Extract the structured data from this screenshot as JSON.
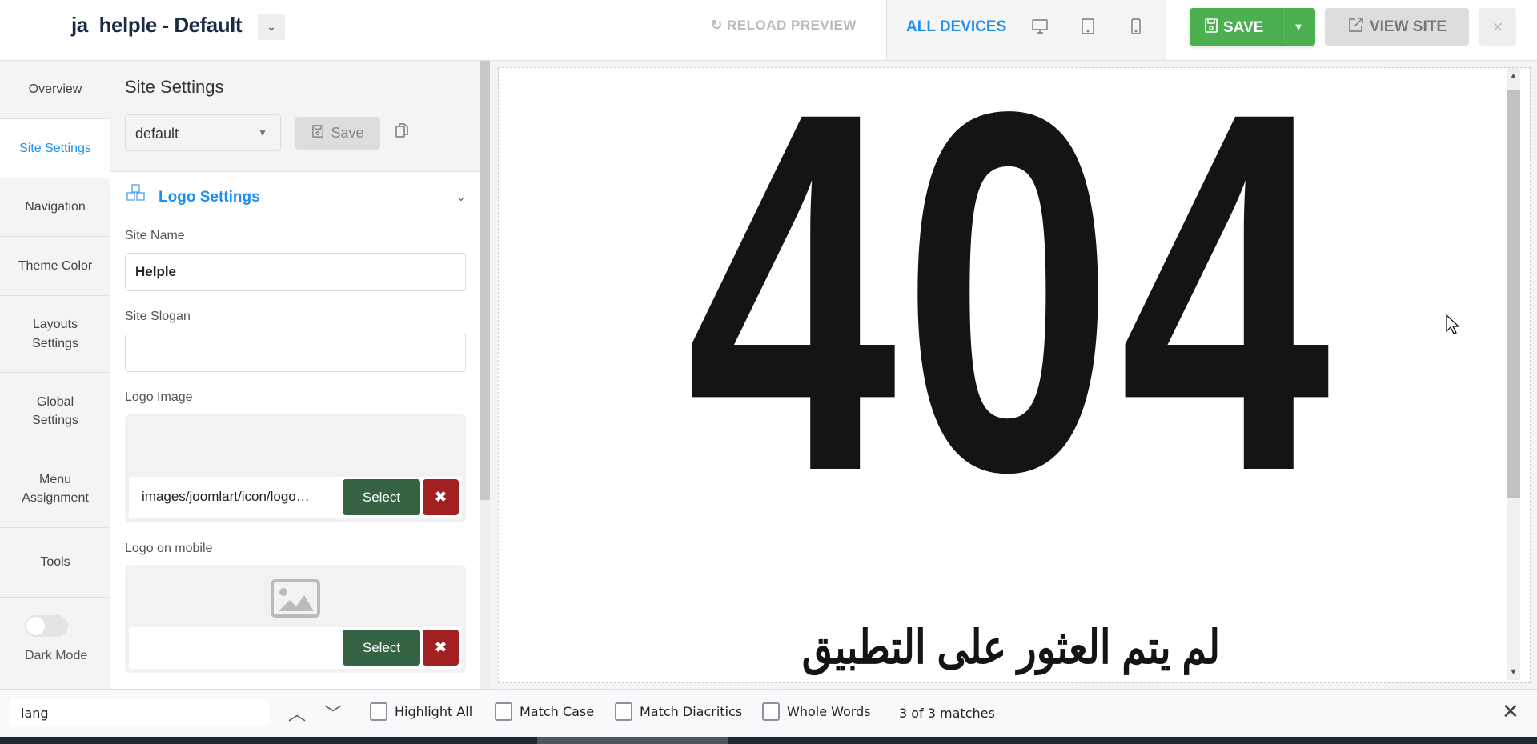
{
  "header": {
    "title": "ja_helple - Default",
    "reload_label": "RELOAD PREVIEW",
    "devices_label": "ALL DEVICES",
    "save_label": "SAVE",
    "view_site_label": "VIEW SITE",
    "close_label": "×"
  },
  "nav": {
    "items": [
      {
        "label": "Overview"
      },
      {
        "label": "Site Settings"
      },
      {
        "label": "Navigation"
      },
      {
        "label": "Theme Color"
      },
      {
        "label": "Layouts Settings"
      },
      {
        "label": "Global Settings"
      },
      {
        "label": "Menu Assignment"
      },
      {
        "label": "Tools"
      }
    ],
    "active": "Site Settings",
    "dark_mode_label": "Dark Mode",
    "dark_mode_on": false
  },
  "panel": {
    "title": "Site Settings",
    "profile_value": "default",
    "save_label": "Save",
    "section_title": "Logo Settings",
    "site_name_label": "Site Name",
    "site_name_value": "Helple",
    "site_slogan_label": "Site Slogan",
    "site_slogan_value": "",
    "logo_image_label": "Logo Image",
    "logo_image_value": "images/joomlart/icon/logo…",
    "logo_mobile_label": "Logo on mobile",
    "logo_mobile_value": "",
    "select_label": "Select",
    "remove_label": "✖"
  },
  "preview": {
    "heading": "404",
    "message": "لم يتم العثور على التطبيق"
  },
  "findbar": {
    "query": "lang",
    "highlight_all": "Highlight All",
    "match_case": "Match Case",
    "match_diacritics": "Match Diacritics",
    "whole_words": "Whole Words",
    "status": "3 of 3 matches"
  },
  "colors": {
    "accent": "#1e8ff0",
    "save_green": "#4caf50",
    "select_green": "#356344",
    "remove_red": "#a32022"
  }
}
